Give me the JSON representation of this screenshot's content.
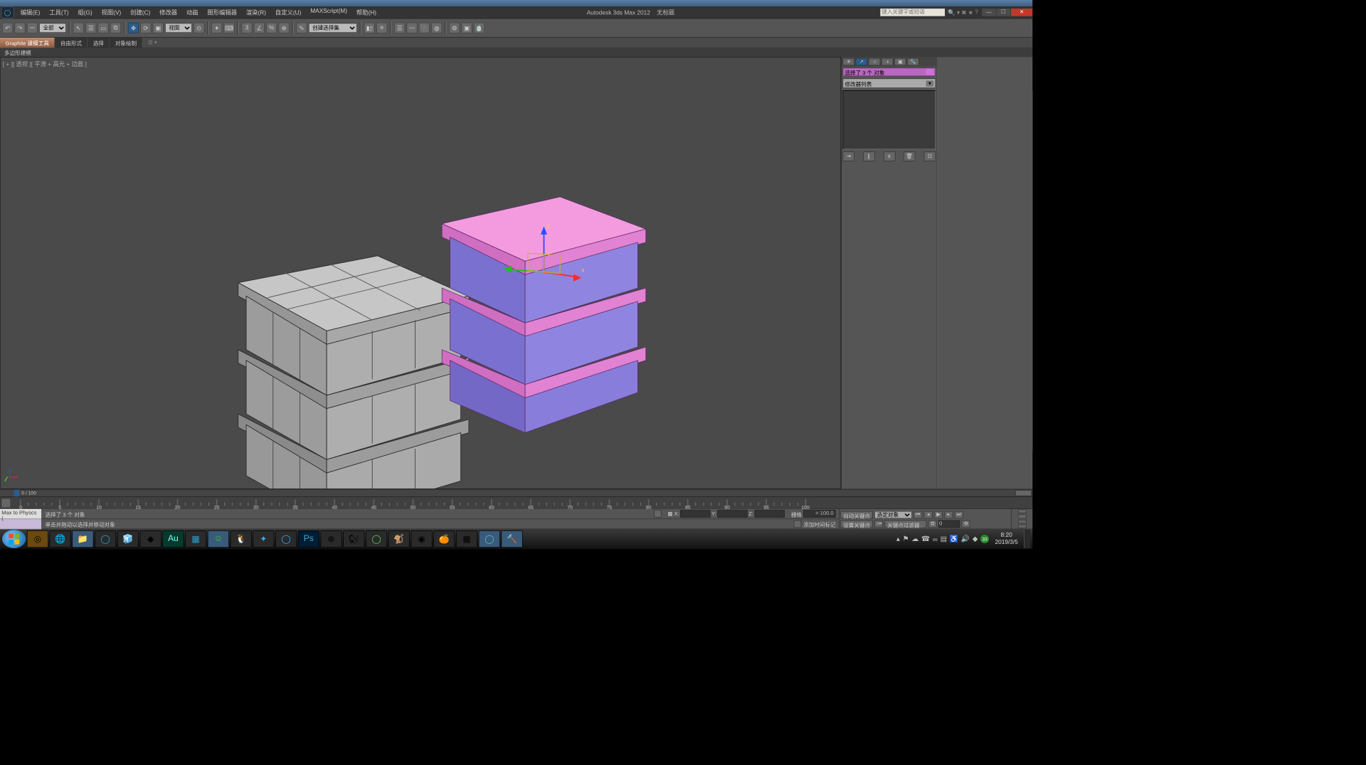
{
  "app": {
    "title": "Autodesk 3ds Max  2012",
    "doc": "无标题"
  },
  "menu": [
    "编辑(E)",
    "工具(T)",
    "组(G)",
    "视图(V)",
    "创建(C)",
    "修改器",
    "动画",
    "图形编辑器",
    "渲染(R)",
    "自定义(U)",
    "MAXScript(M)",
    "帮助(H)"
  ],
  "search_hint": "键入关键字或短语",
  "toolbar": {
    "sel_filter": "全部",
    "view_mode": "视图",
    "named_sel": "创建选择集"
  },
  "ribbon": {
    "tabs": [
      "Graphite 建模工具",
      "自由形式",
      "选择",
      "对象绘制"
    ],
    "active": 0,
    "sub": "多边形建模"
  },
  "viewport": {
    "label": "[ + ][ 透视 ][ 平滑 + 高光 + 边面  ]"
  },
  "panel": {
    "selection_name": "选择了 3 个 对象",
    "modifier_hint": "修改器列表"
  },
  "time": {
    "slider_text": "0 / 100",
    "start": 0,
    "end": 100,
    "step": 5
  },
  "status": {
    "script": "Max to Physcs (",
    "sel": "选择了 3 个 对象",
    "prompt": "单击并拖动以选择并移动对象",
    "x": "",
    "y": "",
    "z": "",
    "grid_label": "栅格",
    "grid_val": "= 100.0",
    "add_time_tag": "添加时间标记",
    "autokey": "自动关键点",
    "setkey": "设置关键点",
    "keysel": "选定对象",
    "keyfilter": "关键点过滤器..."
  },
  "tray": {
    "time": "8:20",
    "date": "2019/3/5"
  }
}
